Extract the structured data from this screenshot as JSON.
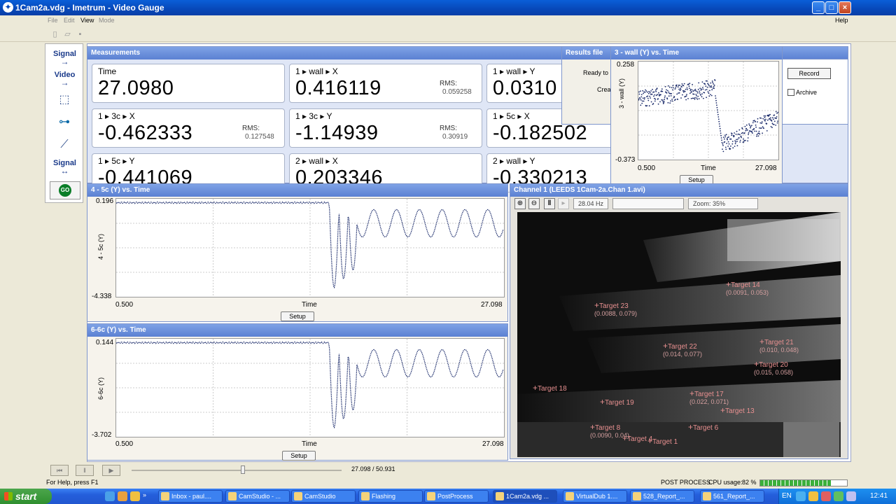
{
  "window": {
    "title": "1Cam2a.vdg - Imetrum - Video Gauge",
    "minimize": "_",
    "maximize": "□",
    "close": "×"
  },
  "menu": {
    "file": "File",
    "edit": "Edit",
    "view": "View",
    "mode": "Mode",
    "help": "Help"
  },
  "toolbar": {
    "new_icon": "new-file-icon",
    "open_icon": "open-folder-icon",
    "save_icon": "save-icon"
  },
  "left_panel": {
    "signal_in": "Signal",
    "video": "Video",
    "signal_out": "Signal",
    "go": "GO"
  },
  "measurements": {
    "title": "Measurements",
    "rms_label": "RMS:",
    "cells": [
      {
        "label": "Time",
        "value": "27.0980",
        "rms": ""
      },
      {
        "label": "1 ▸ wall ▸ X",
        "value": "0.416119",
        "rms": "0.059258"
      },
      {
        "label": "1 ▸ wall ▸ Y",
        "value": "0.0310",
        "rms": ""
      },
      {
        "label": "1 ▸ 3c ▸ X",
        "value": "-0.462333",
        "rms": "0.127548"
      },
      {
        "label": "1 ▸ 3c ▸ Y",
        "value": "-1.14939",
        "rms": "0.30919"
      },
      {
        "label": "1 ▸ 5c ▸ X",
        "value": "-0.182502",
        "rms": ""
      },
      {
        "label": "1 ▸ 5c ▸ Y",
        "value": "-0.441069",
        "rms": ""
      },
      {
        "label": "2 ▸ wall ▸ X",
        "value": "0.203346",
        "rms": ""
      },
      {
        "label": "2 ▸ wall ▸ Y",
        "value": "-0.330213",
        "rms": ""
      }
    ]
  },
  "results_panel": {
    "title": "Results file",
    "ready": "Ready to",
    "create": "Crea",
    "record": "Record",
    "archive": "Archive"
  },
  "wall_graph": {
    "title": "3 - wall (Y) vs. Time",
    "ylabel": "3 - wall (Y)",
    "ymax": "0.258",
    "ymin": "-0.373",
    "xmin": "0.500",
    "xmax": "27.098",
    "xlabel": "Time",
    "setup": "Setup"
  },
  "graph_5c": {
    "title": "4 - 5c (Y) vs. Time",
    "ylabel": "4 - 5c (Y)",
    "ymax": "0.196",
    "ymin": "-4.338",
    "xmin": "0.500",
    "xmax": "27.098",
    "xlabel": "Time",
    "setup": "Setup"
  },
  "graph_6c": {
    "title": "6-6c (Y) vs. Time",
    "ylabel": "6-6c (Y)",
    "ymax": "0.144",
    "ymin": "-3.702",
    "xmin": "0.500",
    "xmax": "27.098",
    "xlabel": "Time",
    "setup": "Setup"
  },
  "channel": {
    "title": "Channel 1 (LEEDS 1Cam-2a.Chan 1.avi)",
    "rate": "28.04 Hz",
    "zoom": "Zoom: 35%",
    "targets": [
      {
        "name": "Target 14",
        "coords": "(0.0091, 0.053)"
      },
      {
        "name": "Target 23",
        "coords": "(0.0088, 0.079)"
      },
      {
        "name": "Target 21",
        "coords": "(0.010, 0.048)"
      },
      {
        "name": "Target 22",
        "coords": "(0.014, 0.077)"
      },
      {
        "name": "Target 20",
        "coords": "(0.015, 0.058)"
      },
      {
        "name": "Target 17",
        "coords": "(0.022, 0.071)"
      },
      {
        "name": "Target 18",
        "coords": ""
      },
      {
        "name": "Target 19",
        "coords": ""
      },
      {
        "name": "Target 13",
        "coords": ""
      },
      {
        "name": "Target 8",
        "coords": "(0.0090, 0.04)"
      },
      {
        "name": "Target 4",
        "coords": ""
      },
      {
        "name": "Target 1",
        "coords": ""
      },
      {
        "name": "Target 6",
        "coords": ""
      }
    ]
  },
  "playback": {
    "position": "27.098 / 50.931"
  },
  "status": {
    "help": "For Help, press F1",
    "mode": "POST PROCESS",
    "cpu": "CPU usage:",
    "cpu_value": "82 %"
  },
  "taskbar": {
    "start": "start",
    "tasks": [
      "Inbox - paul....",
      "CamStudio - ...",
      "CamStudio",
      "Flashing",
      "PostProcess",
      "1Cam2a.vdg ...",
      "VirtualDub 1....",
      "528_Report_...",
      "561_Report_..."
    ],
    "lang": "EN",
    "clock": "12:41"
  }
}
